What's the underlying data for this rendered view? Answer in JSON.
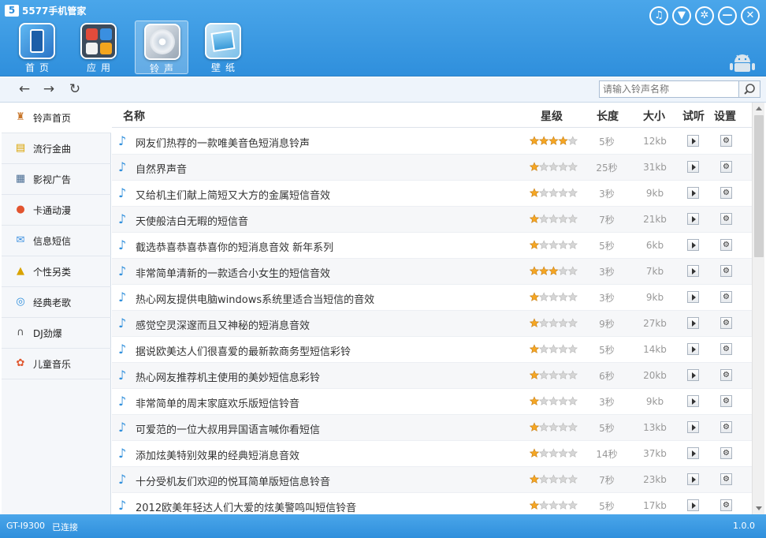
{
  "app": {
    "title": "5577手机管家",
    "logo_letter": "5"
  },
  "window_buttons": [
    {
      "name": "music-icon",
      "glyph": "♫"
    },
    {
      "name": "shirt-icon",
      "glyph": "▼"
    },
    {
      "name": "gear-icon",
      "glyph": "✲"
    },
    {
      "name": "minimize-icon",
      "glyph": "—"
    },
    {
      "name": "close-icon",
      "glyph": "✕"
    }
  ],
  "nav": [
    {
      "label": "首页",
      "icon": "phone-icon"
    },
    {
      "label": "应用",
      "icon": "apps-icon"
    },
    {
      "label": "铃声",
      "icon": "cd-icon",
      "active": true
    },
    {
      "label": "壁纸",
      "icon": "wallpaper-icon"
    }
  ],
  "toolbar": {
    "back": "←",
    "forward": "→",
    "refresh": "↻",
    "search_placeholder": "请输入铃声名称"
  },
  "sidebar": [
    {
      "label": "铃声首页",
      "icon": "home-icon",
      "glyph": "♜",
      "active": true
    },
    {
      "label": "流行金曲",
      "icon": "folder-icon",
      "glyph": "▤"
    },
    {
      "label": "影视广告",
      "icon": "film-icon",
      "glyph": "▦"
    },
    {
      "label": "卡通动漫",
      "icon": "cartoon-icon",
      "glyph": "●"
    },
    {
      "label": "信息短信",
      "icon": "message-icon",
      "glyph": "✉"
    },
    {
      "label": "个性另类",
      "icon": "hat-icon",
      "glyph": "▲"
    },
    {
      "label": "经典老歌",
      "icon": "disc-icon",
      "glyph": "◎"
    },
    {
      "label": "DJ劲爆",
      "icon": "headphones-icon",
      "glyph": "∩"
    },
    {
      "label": "儿童音乐",
      "icon": "palette-icon",
      "glyph": "✿"
    }
  ],
  "columns": {
    "name": "名称",
    "rating": "星级",
    "duration": "长度",
    "size": "大小",
    "preview": "试听",
    "settings": "设置"
  },
  "rows": [
    {
      "name": "网友们热荐的一款唯美音色短消息铃声",
      "stars": 4,
      "duration": "5秒",
      "size": "12kb"
    },
    {
      "name": "自然界声音",
      "stars": 1,
      "duration": "25秒",
      "size": "31kb"
    },
    {
      "name": "又给机主们献上简短又大方的金属短信音效",
      "stars": 1,
      "duration": "3秒",
      "size": "9kb"
    },
    {
      "name": "天使般洁白无暇的短信音",
      "stars": 1,
      "duration": "7秒",
      "size": "21kb"
    },
    {
      "name": "截选恭喜恭喜恭喜你的短消息音效 新年系列",
      "stars": 1,
      "duration": "5秒",
      "size": "6kb"
    },
    {
      "name": "非常简单清新的一款适合小女生的短信音效",
      "stars": 3,
      "duration": "3秒",
      "size": "7kb"
    },
    {
      "name": "热心网友提供电脑windows系统里适合当短信的音效",
      "stars": 1,
      "duration": "3秒",
      "size": "9kb"
    },
    {
      "name": "感觉空灵深邃而且又神秘的短消息音效",
      "stars": 1,
      "duration": "9秒",
      "size": "27kb"
    },
    {
      "name": "据说欧美达人们很喜爱的最新款商务型短信彩铃",
      "stars": 1,
      "duration": "5秒",
      "size": "14kb"
    },
    {
      "name": "热心网友推荐机主使用的美妙短信息彩铃",
      "stars": 1,
      "duration": "6秒",
      "size": "20kb"
    },
    {
      "name": "非常简单的周末家庭欢乐版短信铃音",
      "stars": 1,
      "duration": "3秒",
      "size": "9kb"
    },
    {
      "name": "可爱范的一位大叔用异国语言喊你看短信",
      "stars": 1,
      "duration": "5秒",
      "size": "13kb"
    },
    {
      "name": "添加炫美特别效果的经典短消息音效",
      "stars": 1,
      "duration": "14秒",
      "size": "37kb"
    },
    {
      "name": "十分受机友们欢迎的悦耳简单版短信息铃音",
      "stars": 1,
      "duration": "7秒",
      "size": "23kb"
    },
    {
      "name": "2012欧美年轻达人们大爱的炫美警鸣叫短信铃音",
      "stars": 1,
      "duration": "5秒",
      "size": "17kb"
    }
  ],
  "status": {
    "device": "GT-I9300",
    "connection": "已连接",
    "version": "1.0.0"
  },
  "colors": {
    "accent": "#2f8fdc",
    "star": "#f5a623",
    "star_empty": "#d6d6d6"
  }
}
